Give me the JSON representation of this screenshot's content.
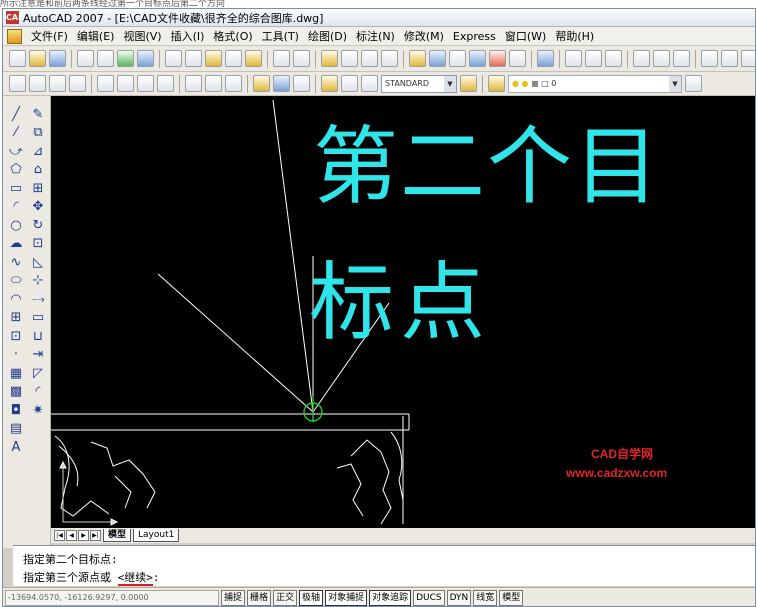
{
  "caption_top": "所示注意是和前后两条线经过第一个目标点后第二个方向",
  "window": {
    "app_icon": "CAD",
    "title": "AutoCAD 2007 - [E:\\CAD文件收藏\\很齐全的综合图库.dwg]"
  },
  "menu": [
    "文件(F)",
    "编辑(E)",
    "视图(V)",
    "插入(I)",
    "格式(O)",
    "工具(T)",
    "绘图(D)",
    "标注(N)",
    "修改(M)",
    "Express",
    "窗口(W)",
    "帮助(H)"
  ],
  "toolbar2": {
    "text_style": "STANDARD",
    "layer": "0"
  },
  "drawing": {
    "text_line1": "第二个目",
    "text_line2": "标点",
    "watermark_line1": "CAD自学网",
    "watermark_line2": "www.cadzxw.com"
  },
  "tabs": {
    "model": "模型",
    "layout": "Layout1"
  },
  "command": {
    "line1": "指定第二个目标点:",
    "line2_prefix": "指定第三个源点或 ",
    "line2_option": "<继续>",
    "line2_suffix": ":"
  },
  "status": {
    "coordinates": "-13694.0570, -16126.9297, 0.0000",
    "buttons": [
      "捕捉",
      "栅格",
      "正交",
      "极轴",
      "对象捕捉",
      "对象追踪",
      "DUCS",
      "DYN",
      "线宽",
      "模型"
    ]
  },
  "colors": {
    "drawing_bg": "#000000",
    "cad_text": "#2fe5ea",
    "watermark": "#e0262a",
    "geometry": "#ffffff",
    "marker": "#22cc22"
  }
}
